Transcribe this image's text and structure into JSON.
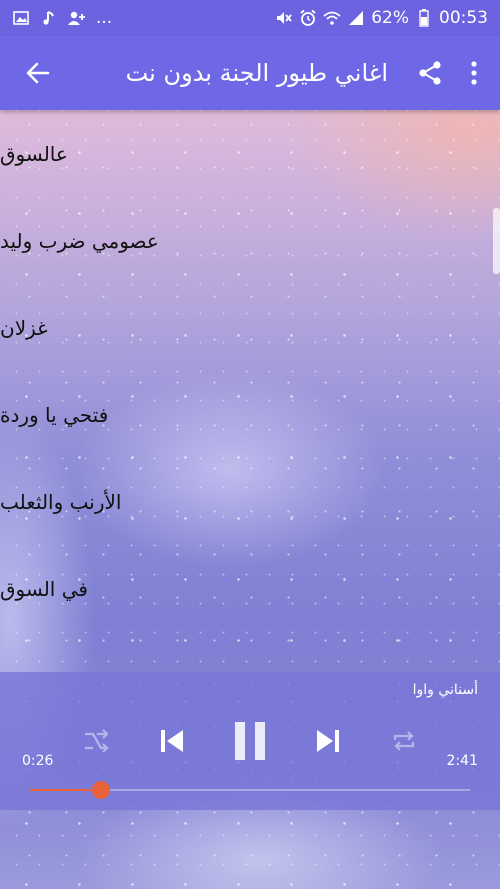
{
  "status_bar": {
    "left_icons": [
      "image-icon",
      "music-note-icon",
      "add-contact-icon"
    ],
    "overflow": "...",
    "right_icons": [
      "mute-icon",
      "alarm-icon",
      "wifi-icon",
      "signal-icon"
    ],
    "battery_percent": "62%",
    "time": "00:53"
  },
  "app_bar": {
    "title": "اغاني طيور الجنة بدون نت",
    "back_icon": "arrow-left-icon",
    "share_icon": "share-icon",
    "menu_icon": "more-vert-icon"
  },
  "songs": [
    "عالسوق",
    "عصومي ضرب وليد",
    "غزلان",
    "فتحي يا وردة",
    "الأرنب والثعلب",
    "في السوق"
  ],
  "player": {
    "now_playing": "أسناني واوا",
    "elapsed": "0:26",
    "duration": "2:41",
    "progress": 0.161,
    "controls": [
      "shuffle-icon",
      "previous-icon",
      "pause-icon",
      "next-icon",
      "repeat-icon"
    ]
  },
  "colors": {
    "status_bar": "#6b63e0",
    "app_bar": "#6e67e6",
    "accent": "#e8623a"
  }
}
